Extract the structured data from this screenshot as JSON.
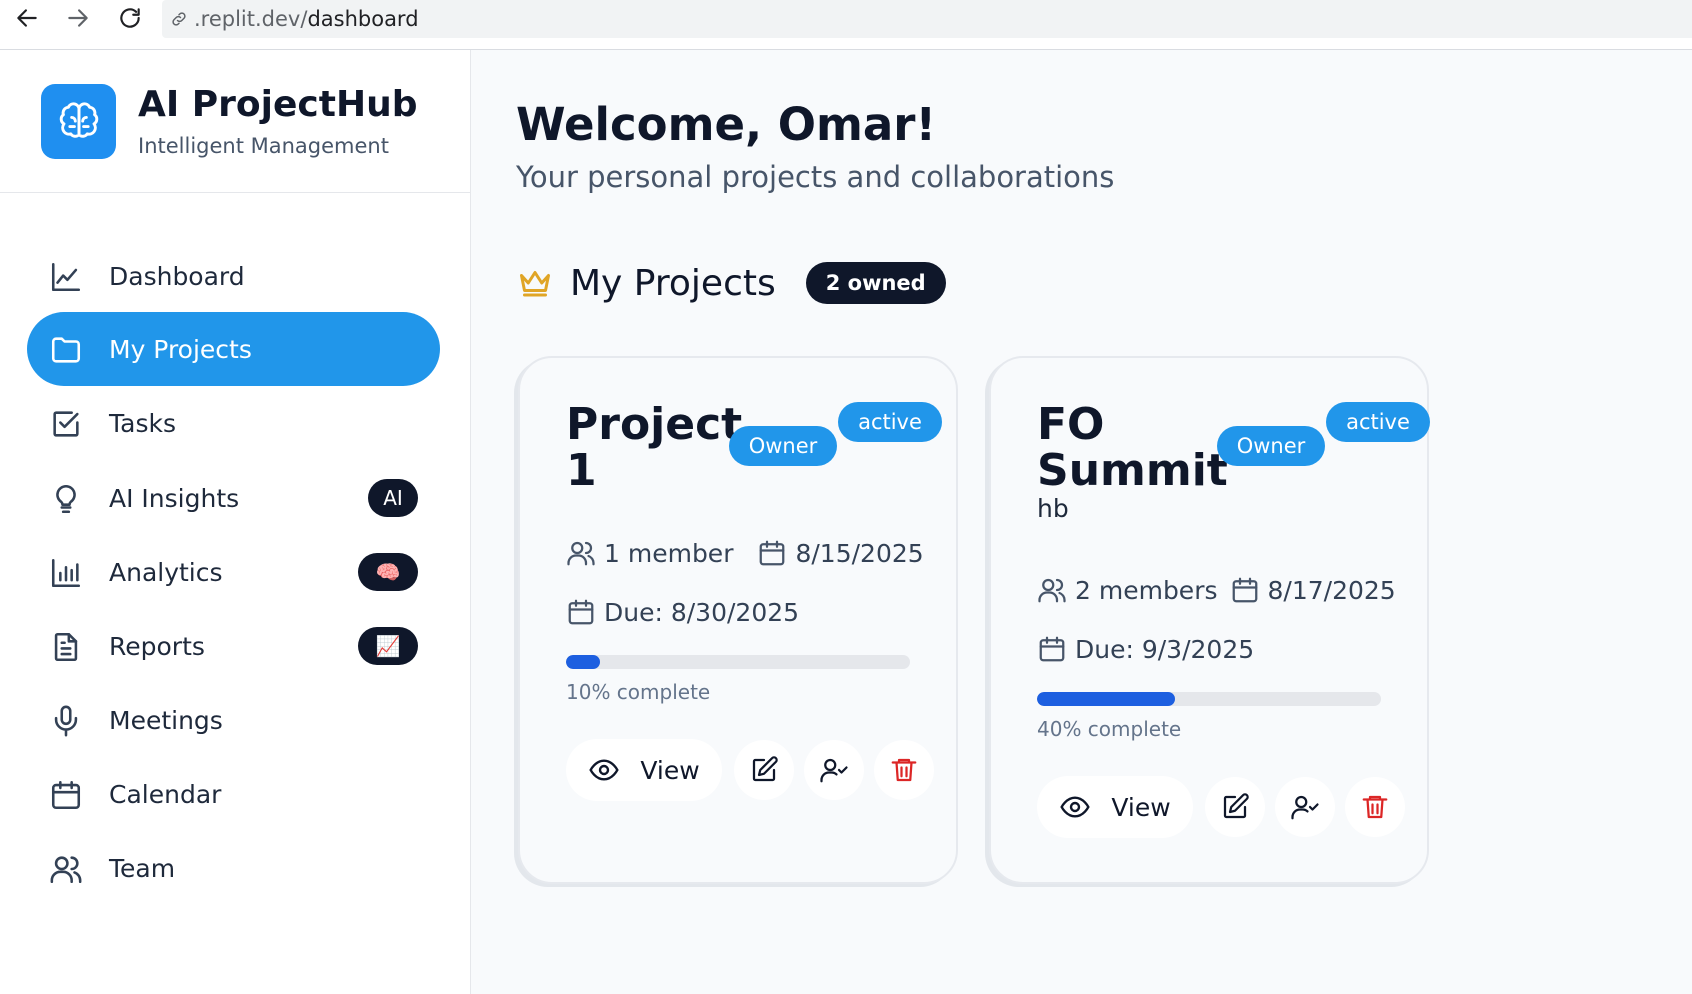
{
  "browser": {
    "url_host": ".replit.dev/",
    "url_path": "dashboard",
    "back_icon": "arrow-left-icon",
    "forward_icon": "arrow-right-icon",
    "reload_icon": "reload-icon"
  },
  "brand": {
    "title": "AI ProjectHub",
    "subtitle": "Intelligent Management",
    "logo_icon": "brain-icon",
    "accent_color": "#1f8ff0"
  },
  "sidebar": {
    "items": [
      {
        "label": "Dashboard",
        "icon": "line-chart-icon",
        "active": false
      },
      {
        "label": "My Projects",
        "icon": "folder-icon",
        "active": true
      },
      {
        "label": "Tasks",
        "icon": "checkbox-icon",
        "active": false
      },
      {
        "label": "AI Insights",
        "icon": "lightbulb-icon",
        "active": false,
        "badge": "AI"
      },
      {
        "label": "Analytics",
        "icon": "bar-chart-icon",
        "active": false,
        "badge": "🧠"
      },
      {
        "label": "Reports",
        "icon": "document-icon",
        "active": false,
        "badge": "📈"
      },
      {
        "label": "Meetings",
        "icon": "microphone-icon",
        "active": false
      },
      {
        "label": "Calendar",
        "icon": "calendar-icon",
        "active": false
      },
      {
        "label": "Team",
        "icon": "users-icon",
        "active": false
      }
    ]
  },
  "main": {
    "welcome": "Welcome, Omar!",
    "subtitle": "Your personal projects and collaborations",
    "section_title": "My Projects",
    "owned_badge": "2 owned"
  },
  "projects": [
    {
      "title": "Project\n1",
      "description": "",
      "role": "Owner",
      "status": "active",
      "members": "1 member",
      "start_date": "8/15/2025",
      "due": "Due: 8/30/2025",
      "progress": 0.1,
      "progress_label": "10% complete",
      "view_label": "View"
    },
    {
      "title": "FO\nSummit",
      "description": "hb",
      "role": "Owner",
      "status": "active",
      "members": "2 members",
      "start_date": "8/17/2025",
      "due": "Due: 9/3/2025",
      "progress": 0.4,
      "progress_label": "40% complete",
      "view_label": "View"
    }
  ]
}
